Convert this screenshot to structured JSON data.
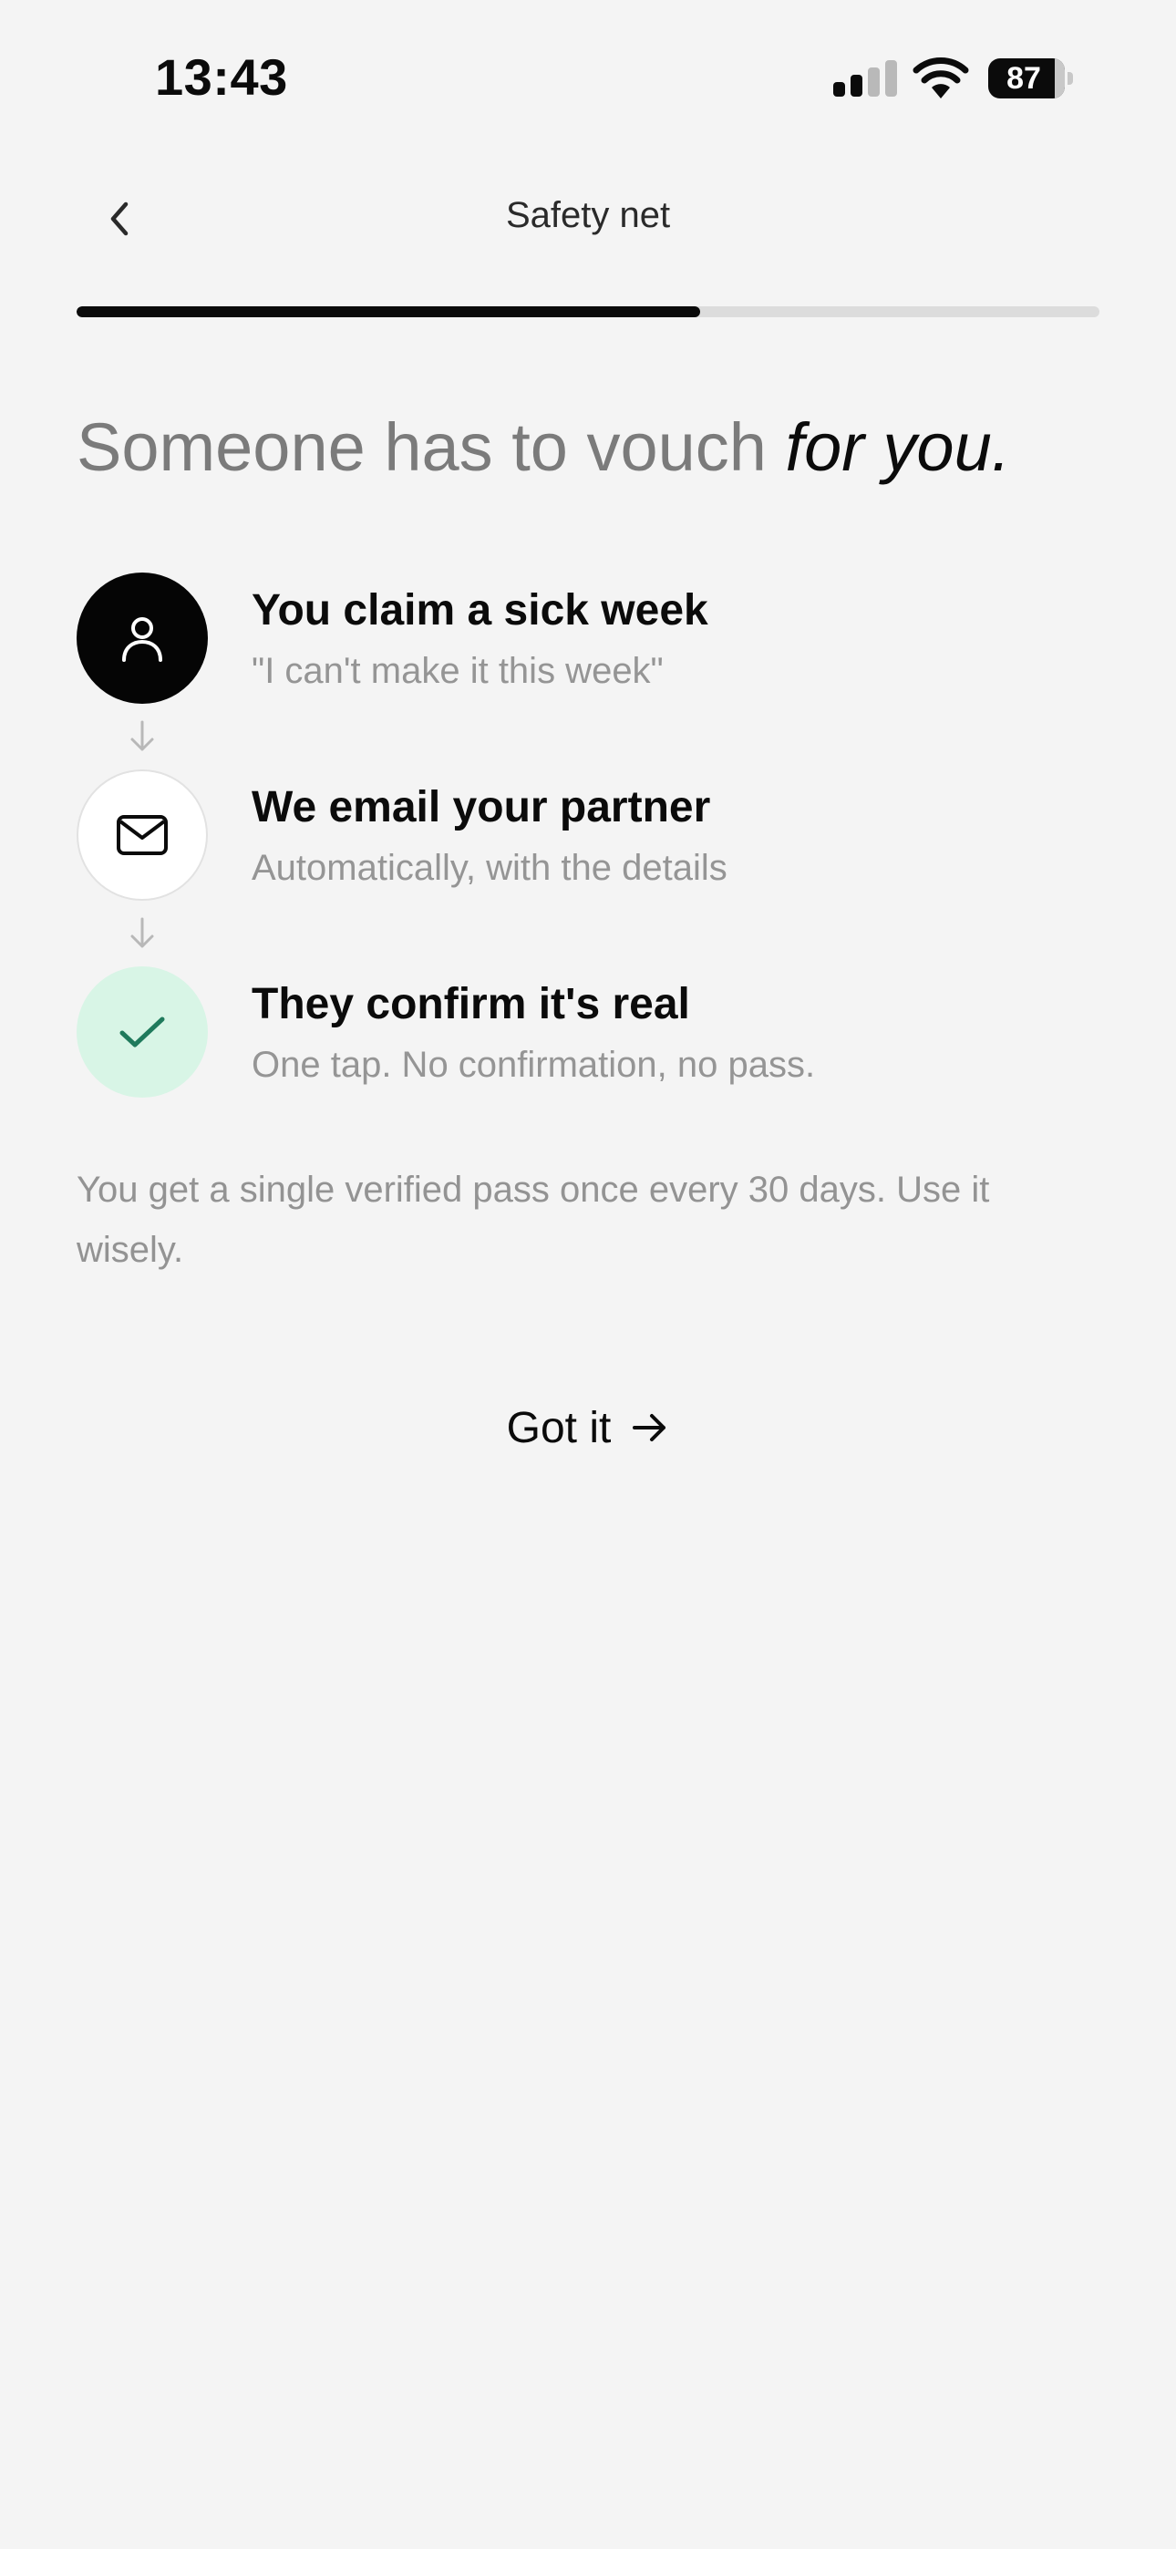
{
  "status_bar": {
    "time": "13:43",
    "battery_level": "87",
    "signal_bars_active": 2,
    "signal_bars_total": 4
  },
  "header": {
    "title": "Safety net",
    "back_icon": "chevron-left-icon"
  },
  "progress": {
    "fraction": 0.61
  },
  "headline": {
    "plain": "Someone has to vouch ",
    "emphasis": "for you."
  },
  "steps": [
    {
      "icon": "person-icon",
      "title": "You claim a sick week",
      "subtitle": "\"I can't make it this week\""
    },
    {
      "icon": "mail-icon",
      "title": "We email your partner",
      "subtitle": "Automatically, with the details"
    },
    {
      "icon": "check-icon",
      "title": "They confirm it's real",
      "subtitle": "One tap. No confirmation, no pass."
    }
  ],
  "note": "You get a single verified pass once every 30 days. Use it wisely.",
  "cta": {
    "label": "Got it",
    "icon": "arrow-right-icon"
  },
  "colors": {
    "background": "#f4f4f4",
    "primary": "#0b0b0b",
    "muted_text": "#959595",
    "progress_track": "#dcdcdc",
    "success_bg": "#d8f5e6",
    "success_icon": "#1f7a5c"
  }
}
